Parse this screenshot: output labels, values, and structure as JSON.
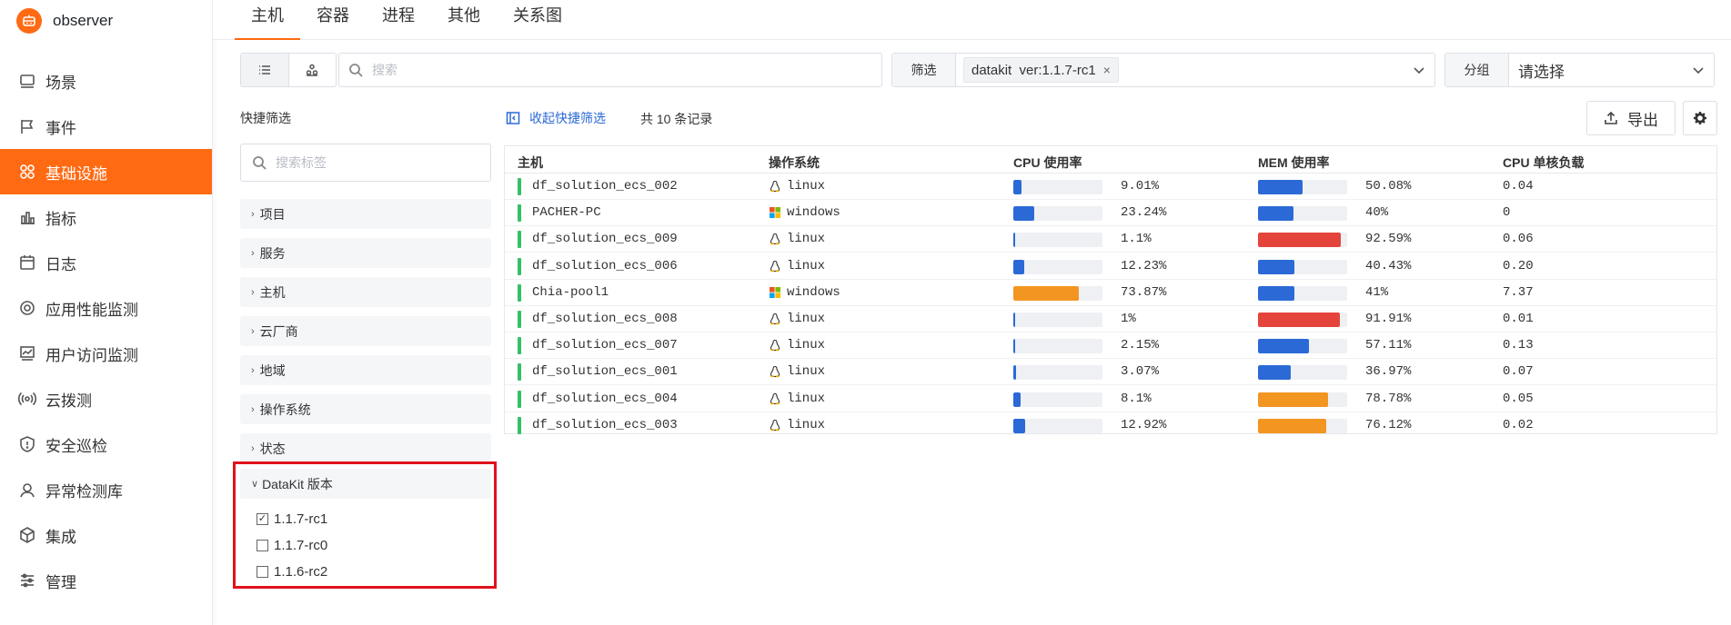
{
  "app": {
    "name": "observer"
  },
  "colors": {
    "accent": "#ff6a13",
    "blue": "#2b6ad6",
    "red": "#e5443c",
    "orange": "#f39621",
    "green": "#34c068"
  },
  "sidebar": {
    "items": [
      {
        "label": "场景",
        "icon": "scene-icon",
        "active": false
      },
      {
        "label": "事件",
        "icon": "flag-icon",
        "active": false
      },
      {
        "label": "基础设施",
        "icon": "infrastructure-icon",
        "active": true
      },
      {
        "label": "指标",
        "icon": "bar-chart-icon",
        "active": false
      },
      {
        "label": "日志",
        "icon": "calendar-icon",
        "active": false
      },
      {
        "label": "应用性能监测",
        "icon": "apm-icon",
        "active": false
      },
      {
        "label": "用户访问监测",
        "icon": "rum-icon",
        "active": false
      },
      {
        "label": "云拨测",
        "icon": "signal-icon",
        "active": false
      },
      {
        "label": "安全巡检",
        "icon": "shield-icon",
        "active": false
      },
      {
        "label": "异常检测库",
        "icon": "monitor-icon",
        "active": false
      },
      {
        "label": "集成",
        "icon": "cube-icon",
        "active": false
      },
      {
        "label": "管理",
        "icon": "sliders-icon",
        "active": false
      }
    ]
  },
  "tabs": [
    {
      "label": "主机",
      "active": true
    },
    {
      "label": "容器",
      "active": false
    },
    {
      "label": "进程",
      "active": false
    },
    {
      "label": "其他",
      "active": false
    },
    {
      "label": "关系图",
      "active": false
    }
  ],
  "search": {
    "placeholder": "搜索"
  },
  "filter": {
    "label": "筛选",
    "tag": "datakit  ver:1.1.7-rc1",
    "remove": "×"
  },
  "group": {
    "label": "分组",
    "value": "请选择"
  },
  "quick_filter": {
    "title": "快捷筛选",
    "search_placeholder": "搜索标签",
    "groups": [
      "项目",
      "服务",
      "主机",
      "云厂商",
      "地域",
      "操作系统",
      "状态"
    ],
    "datakit": {
      "title": "DataKit 版本",
      "options": [
        {
          "label": "1.1.7-rc1",
          "checked": true
        },
        {
          "label": "1.1.7-rc0",
          "checked": false
        },
        {
          "label": "1.1.6-rc2",
          "checked": false
        }
      ]
    }
  },
  "list": {
    "collapse_label": "收起快捷筛选",
    "record_count": "共 10 条记录",
    "export_label": "导出"
  },
  "table": {
    "columns": [
      "主机",
      "操作系统",
      "CPU 使用率",
      "MEM 使用率",
      "CPU 单核负载"
    ],
    "rows": [
      {
        "host": "df_solution_ecs_002",
        "os": "linux",
        "cpu": 9.01,
        "cpu_text": "9.01%",
        "mem": 50.08,
        "mem_text": "50.08%",
        "load": "0.04"
      },
      {
        "host": "PACHER-PC",
        "os": "windows",
        "cpu": 23.24,
        "cpu_text": "23.24%",
        "mem": 40,
        "mem_text": "40%",
        "load": "0"
      },
      {
        "host": "df_solution_ecs_009",
        "os": "linux",
        "cpu": 1.1,
        "cpu_text": "1.1%",
        "mem": 92.59,
        "mem_text": "92.59%",
        "load": "0.06"
      },
      {
        "host": "df_solution_ecs_006",
        "os": "linux",
        "cpu": 12.23,
        "cpu_text": "12.23%",
        "mem": 40.43,
        "mem_text": "40.43%",
        "load": "0.20"
      },
      {
        "host": "Chia-pool1",
        "os": "windows",
        "cpu": 73.87,
        "cpu_text": "73.87%",
        "mem": 41,
        "mem_text": "41%",
        "load": "7.37"
      },
      {
        "host": "df_solution_ecs_008",
        "os": "linux",
        "cpu": 1,
        "cpu_text": "1%",
        "mem": 91.91,
        "mem_text": "91.91%",
        "load": "0.01"
      },
      {
        "host": "df_solution_ecs_007",
        "os": "linux",
        "cpu": 2.15,
        "cpu_text": "2.15%",
        "mem": 57.11,
        "mem_text": "57.11%",
        "load": "0.13"
      },
      {
        "host": "df_solution_ecs_001",
        "os": "linux",
        "cpu": 3.07,
        "cpu_text": "3.07%",
        "mem": 36.97,
        "mem_text": "36.97%",
        "load": "0.07"
      },
      {
        "host": "df_solution_ecs_004",
        "os": "linux",
        "cpu": 8.1,
        "cpu_text": "8.1%",
        "mem": 78.78,
        "mem_text": "78.78%",
        "load": "0.05"
      },
      {
        "host": "df_solution_ecs_003",
        "os": "linux",
        "cpu": 12.92,
        "cpu_text": "12.92%",
        "mem": 76.12,
        "mem_text": "76.12%",
        "load": "0.02"
      }
    ]
  }
}
